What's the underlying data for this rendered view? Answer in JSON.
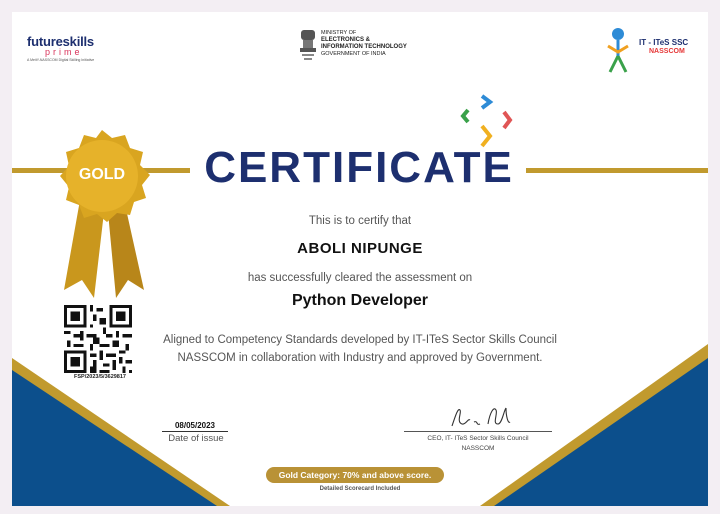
{
  "header": {
    "futureskills": {
      "main": "futureskills",
      "prime": "prime",
      "tagline": "A MeitY-NASSCOM Digital Skilling Initiative"
    },
    "ministry": {
      "line1": "MINISTRY OF",
      "line2": "ELECTRONICS &",
      "line3": "INFORMATION TECHNOLOGY",
      "line4": "GOVERNMENT OF INDIA"
    },
    "ssc": {
      "line1": "IT - ITeS SSC",
      "line2": "NASSCOM"
    }
  },
  "badge": {
    "label": "GOLD"
  },
  "title": "CERTIFICATE",
  "body": {
    "certify_text": "This is to certify that",
    "recipient_name": "ABOLI NIPUNGE",
    "cleared_text": "has successfully cleared the assessment on",
    "course": "Python Developer",
    "aligned_line1": "Aligned to Competency Standards developed by IT-ITeS Sector Skills Council",
    "aligned_line2": "NASSCOM in collaboration with Industry and approved by Government."
  },
  "qr": {
    "id": "FSP/2023/5/3629817"
  },
  "issue": {
    "date": "08/05/2023",
    "label": "Date of issue"
  },
  "signature": {
    "title_line1": "CEO, IT- ITeS Sector Skills Council",
    "title_line2": "NASSCOM"
  },
  "footer": {
    "category": "Gold Category: 70% and above score.",
    "scorecard": "Detailed Scorecard Included"
  },
  "colors": {
    "navy": "#1d2f6f",
    "gold": "#c19a2e",
    "blue_corner": "#0c4f8c"
  }
}
